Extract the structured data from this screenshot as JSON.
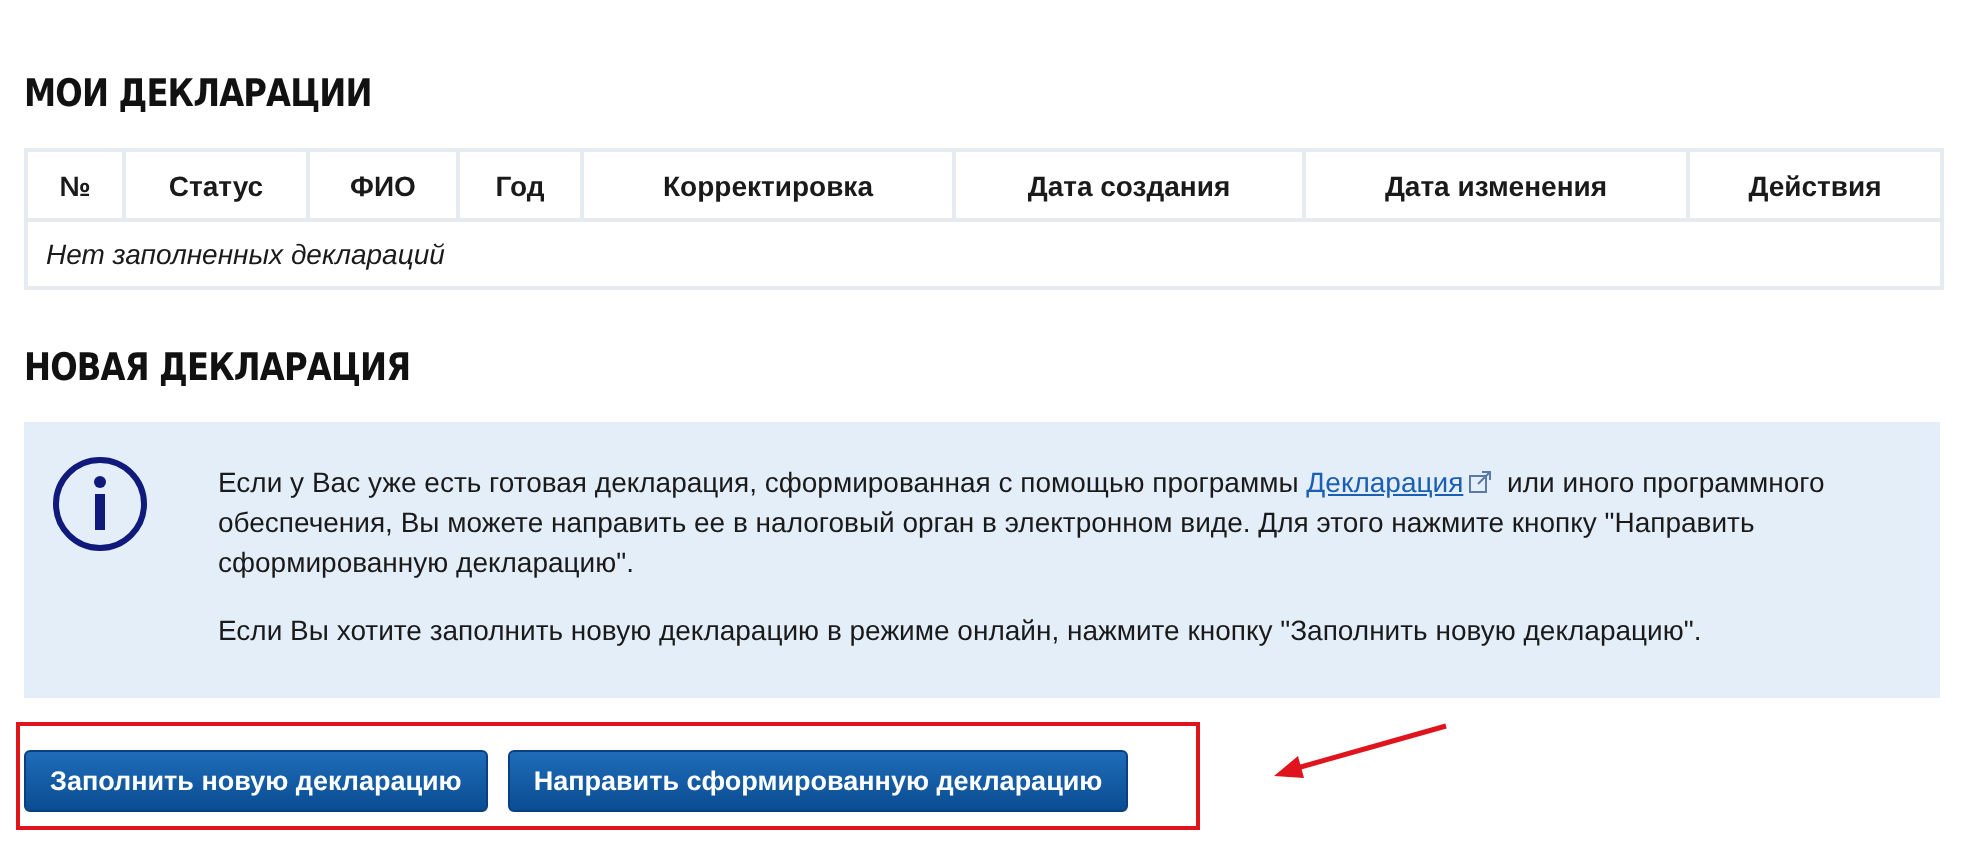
{
  "my_declarations": {
    "title": "МОИ ДЕКЛАРАЦИИ",
    "table": {
      "columns": [
        "№",
        "Статус",
        "ФИО",
        "Год",
        "Корректировка",
        "Дата создания",
        "Дата изменения",
        "Действия"
      ],
      "empty_message": "Нет заполненных деклараций"
    }
  },
  "new_declaration": {
    "title": "НОВАЯ ДЕКЛАРАЦИЯ",
    "info": {
      "paragraphs": [
        {
          "text_before": "Если у Вас уже есть готовая декларация, сформированная с помощью программы ",
          "link": "Декларация",
          "text_after": " или иного программного обеспечения, Вы можете направить ее в налоговый орган в электронном виде. Для этого нажмите кнопку \"Направить сформированную декларацию\"."
        },
        {
          "text_before": "Если Вы хотите заполнить новую декларацию в режиме онлайн, нажмите кнопку \"Заполнить новую декларацию\"."
        }
      ]
    },
    "buttons": [
      "Заполнить новую декларацию",
      "Направить сформированную декларацию"
    ]
  }
}
